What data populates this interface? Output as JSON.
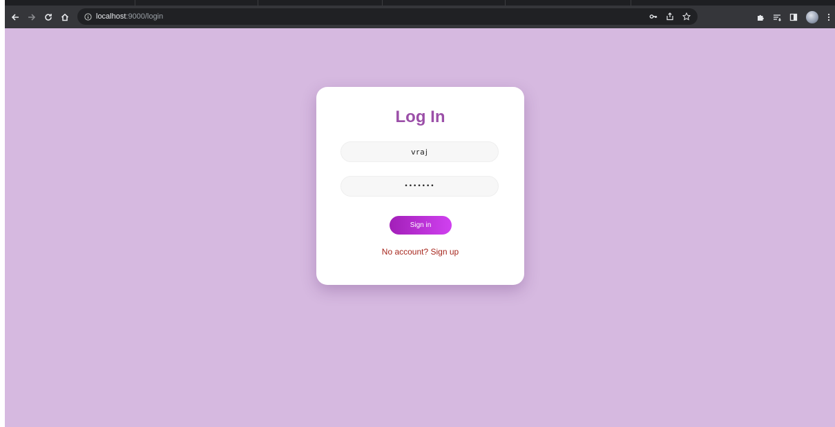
{
  "browser": {
    "url_host": "localhost",
    "url_path": ":9000/login",
    "icons": {
      "back": "back-arrow-icon",
      "forward": "forward-arrow-icon",
      "reload": "reload-icon",
      "home": "home-icon",
      "site_info": "info-icon",
      "password": "key-icon",
      "share": "share-icon",
      "bookmark": "star-icon",
      "extensions": "puzzle-icon",
      "reading_list": "reading-list-icon",
      "side_panel": "side-panel-icon",
      "profile": "avatar",
      "menu": "kebab-menu-icon"
    },
    "toolbar_color": "#35363a",
    "omnibox_color": "#202124"
  },
  "page": {
    "background_color": "#d6b9e0"
  },
  "login": {
    "title": "Log In",
    "username_value": "vraj",
    "password_value": "•••••••",
    "signin_label": "Sign in",
    "signup_text": "No account? Sign up",
    "title_color": "#9b4fa8",
    "button_gradient": [
      "#a21fb8",
      "#d041f0"
    ],
    "link_color": "#a6251c"
  }
}
